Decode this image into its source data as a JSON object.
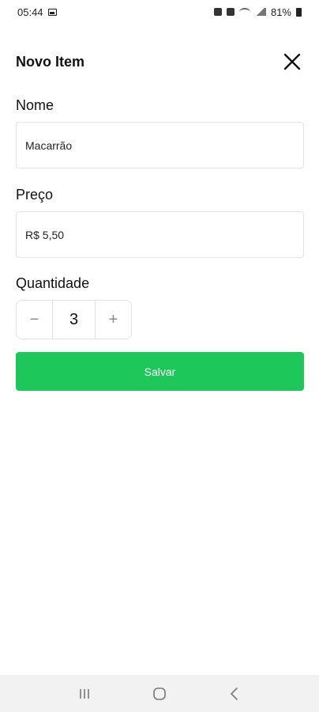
{
  "status_bar": {
    "time": "05:44",
    "battery": "81%"
  },
  "header": {
    "title": "Novo Item"
  },
  "form": {
    "name_label": "Nome",
    "name_value": "Macarrão",
    "price_label": "Preço",
    "price_value": "R$ 5,50",
    "quantity_label": "Quantidade",
    "quantity_value": "3",
    "decrement_symbol": "−",
    "increment_symbol": "+"
  },
  "actions": {
    "save_label": "Salvar"
  },
  "colors": {
    "accent": "#1ec759",
    "border": "#e3e3e3",
    "nav_bar": "#f2f2f2"
  },
  "icons": [
    "gallery-icon",
    "alarm-icon",
    "mute-icon",
    "wifi-icon",
    "signal-icon",
    "battery-icon",
    "close-icon",
    "recent-apps-icon",
    "home-icon",
    "back-icon"
  ]
}
